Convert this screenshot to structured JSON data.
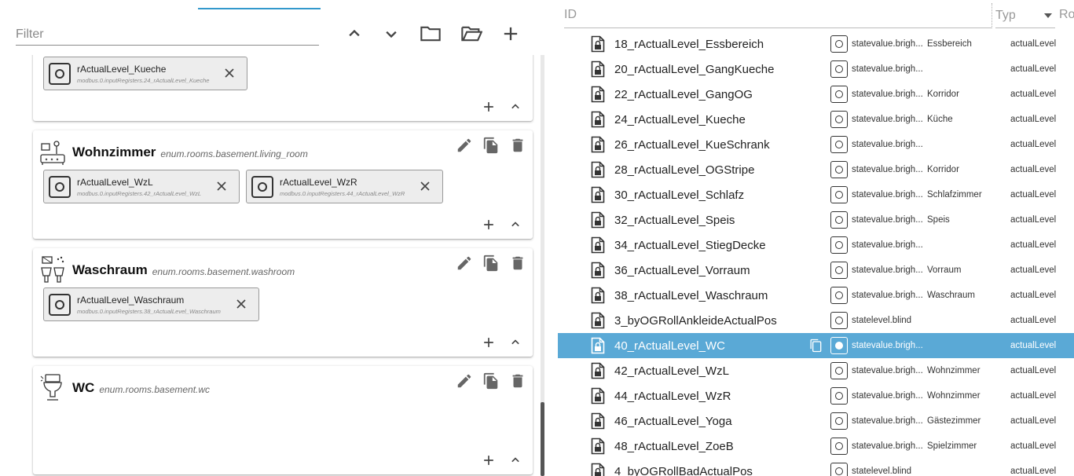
{
  "left": {
    "filter_placeholder": "Filter",
    "toolbar": [
      {
        "name": "collapse-all-button",
        "icon": "chevron-up-icon"
      },
      {
        "name": "expand-all-button",
        "icon": "chevron-down-icon"
      },
      {
        "name": "folder-button",
        "icon": "folder-icon"
      },
      {
        "name": "folder-open-button",
        "icon": "folder-open-icon"
      },
      {
        "name": "add-button",
        "icon": "plus-icon"
      }
    ],
    "cards": [
      {
        "key": "kueche",
        "name": "",
        "id": "",
        "icon": "",
        "chips": [
          {
            "name": "rActualLevel_Kueche",
            "id": "modbus.0.inputRegisters.24_rActualLevel_Kueche"
          }
        ]
      },
      {
        "key": "wohnzimmer",
        "name": "Wohnzimmer",
        "id": "enum.rooms.basement.living_room",
        "icon": "living-room-icon",
        "chips": [
          {
            "name": "rActualLevel_WzL",
            "id": "modbus.0.inputRegisters.42_rActualLevel_WzL"
          },
          {
            "name": "rActualLevel_WzR",
            "id": "modbus.0.inputRegisters.44_rActualLevel_WzR"
          }
        ]
      },
      {
        "key": "waschraum",
        "name": "Waschraum",
        "id": "enum.rooms.basement.washroom",
        "icon": "washroom-icon",
        "chips": [
          {
            "name": "rActualLevel_Waschraum",
            "id": "modbus.0.inputRegisters.38_rActualLevel_Waschraum"
          }
        ]
      },
      {
        "key": "wc",
        "name": "WC",
        "id": "enum.rooms.basement.wc",
        "icon": "toilet-icon",
        "chips": []
      }
    ]
  },
  "right": {
    "header": {
      "id_placeholder": "ID",
      "type_label": "Typ",
      "role_label": "Ro"
    },
    "rows": [
      {
        "name": "18_rActualLevel_Essbereich",
        "role": "statevalue.brigh...",
        "room": "Essbereich",
        "func": "actualLevel",
        "selected": false
      },
      {
        "name": "20_rActualLevel_GangKueche",
        "role": "statevalue.brigh...",
        "room": "",
        "func": "actualLevel",
        "selected": false
      },
      {
        "name": "22_rActualLevel_GangOG",
        "role": "statevalue.brigh...",
        "room": "Korridor",
        "func": "actualLevel",
        "selected": false
      },
      {
        "name": "24_rActualLevel_Kueche",
        "role": "statevalue.brigh...",
        "room": "Küche",
        "func": "actualLevel",
        "selected": false
      },
      {
        "name": "26_rActualLevel_KueSchrank",
        "role": "statevalue.brigh...",
        "room": "",
        "func": "actualLevel",
        "selected": false
      },
      {
        "name": "28_rActualLevel_OGStripe",
        "role": "statevalue.brigh...",
        "room": "Korridor",
        "func": "actualLevel",
        "selected": false
      },
      {
        "name": "30_rActualLevel_Schlafz",
        "role": "statevalue.brigh...",
        "room": "Schlafzimmer",
        "func": "actualLevel",
        "selected": false
      },
      {
        "name": "32_rActualLevel_Speis",
        "role": "statevalue.brigh...",
        "room": "Speis",
        "func": "actualLevel",
        "selected": false
      },
      {
        "name": "34_rActualLevel_StiegDecke",
        "role": "statevalue.brigh...",
        "room": "",
        "func": "actualLevel",
        "selected": false
      },
      {
        "name": "36_rActualLevel_Vorraum",
        "role": "statevalue.brigh...",
        "room": "Vorraum",
        "func": "actualLevel",
        "selected": false
      },
      {
        "name": "38_rActualLevel_Waschraum",
        "role": "statevalue.brigh...",
        "room": "Waschraum",
        "func": "actualLevel",
        "selected": false
      },
      {
        "name": "3_byOGRollAnkleideActualPos",
        "role": "statelevel.blind",
        "room": "",
        "func": "actualLevel",
        "selected": false
      },
      {
        "name": "40_rActualLevel_WC",
        "role": "statevalue.brigh...",
        "room": "",
        "func": "actualLevel",
        "selected": true
      },
      {
        "name": "42_rActualLevel_WzL",
        "role": "statevalue.brigh...",
        "room": "Wohnzimmer",
        "func": "actualLevel",
        "selected": false
      },
      {
        "name": "44_rActualLevel_WzR",
        "role": "statevalue.brigh...",
        "room": "Wohnzimmer",
        "func": "actualLevel",
        "selected": false
      },
      {
        "name": "46_rActualLevel_Yoga",
        "role": "statevalue.brigh...",
        "room": "Gästezimmer",
        "func": "actualLevel",
        "selected": false
      },
      {
        "name": "48_rActualLevel_ZoeB",
        "role": "statevalue.brigh...",
        "room": "Spielzimmer",
        "func": "actualLevel",
        "selected": false
      },
      {
        "name": "4_byOGRollBadActualPos",
        "role": "statelevel.blind",
        "room": "",
        "func": "actualLevel",
        "selected": false
      }
    ]
  },
  "colors": {
    "accent": "#3399cc",
    "selected_row": "#5aa9d6"
  }
}
